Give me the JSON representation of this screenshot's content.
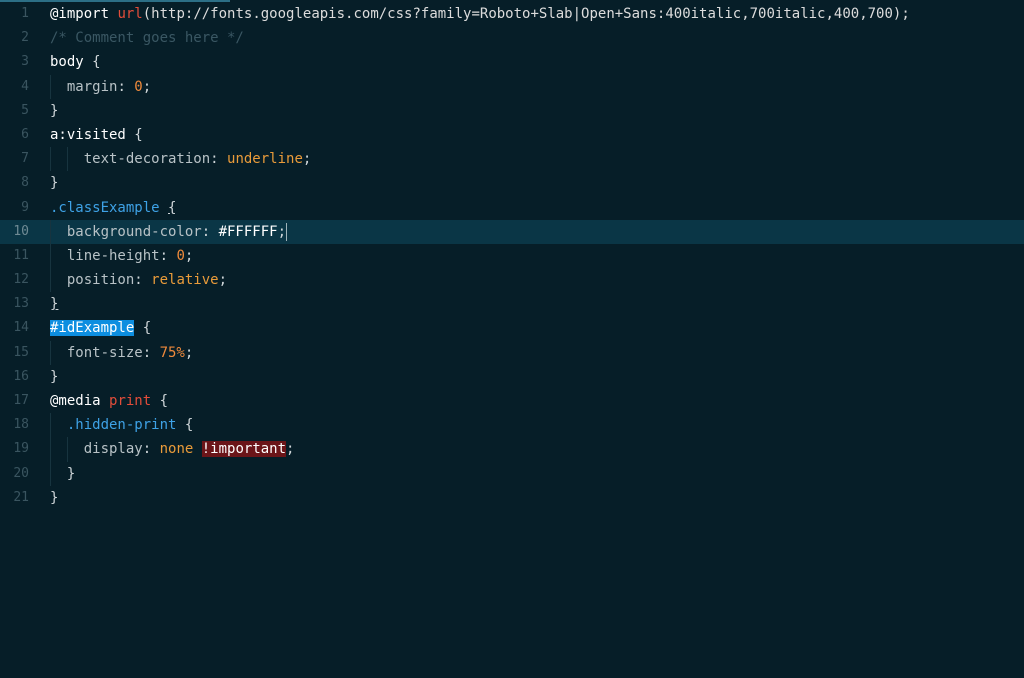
{
  "editor": {
    "language": "css",
    "active_line": 10,
    "lines": [
      {
        "num": "1",
        "tokens": [
          {
            "t": "@import",
            "c": "kw"
          },
          {
            "t": " "
          },
          {
            "t": "url",
            "c": "fn"
          },
          {
            "t": "(http://fonts.googleapis.com/css?family=Roboto+Slab|Open+Sans:400italic,700italic,400,700);",
            "c": "str"
          }
        ]
      },
      {
        "num": "2",
        "tokens": [
          {
            "t": "/* Comment goes here */",
            "c": "cm"
          }
        ]
      },
      {
        "num": "3",
        "tokens": [
          {
            "t": "body",
            "c": "kw"
          },
          {
            "t": " {",
            "c": "punct"
          }
        ]
      },
      {
        "num": "4",
        "tokens": [
          {
            "t": "  "
          },
          {
            "t": "margin",
            "c": "prop"
          },
          {
            "t": ": ",
            "c": "punct"
          },
          {
            "t": "0",
            "c": "num"
          },
          {
            "t": ";",
            "c": "punct"
          }
        ]
      },
      {
        "num": "5",
        "tokens": [
          {
            "t": "}",
            "c": "punct"
          }
        ]
      },
      {
        "num": "6",
        "tokens": [
          {
            "t": "a:visited",
            "c": "kw"
          },
          {
            "t": " {",
            "c": "punct"
          }
        ]
      },
      {
        "num": "7",
        "tokens": [
          {
            "t": "    "
          },
          {
            "t": "text-decoration",
            "c": "prop"
          },
          {
            "t": ": ",
            "c": "punct"
          },
          {
            "t": "underline",
            "c": "val"
          },
          {
            "t": ";",
            "c": "punct"
          }
        ]
      },
      {
        "num": "8",
        "tokens": [
          {
            "t": "}",
            "c": "punct"
          }
        ]
      },
      {
        "num": "9",
        "tokens": [
          {
            "t": ".classExample",
            "c": "sel-class"
          },
          {
            "t": " "
          },
          {
            "t": "{",
            "c": "punct underline-brace"
          }
        ]
      },
      {
        "num": "10",
        "tokens": [
          {
            "t": "  "
          },
          {
            "t": "background-color",
            "c": "prop"
          },
          {
            "t": ": ",
            "c": "punct"
          },
          {
            "t": "#FFFFFF",
            "c": "hex"
          },
          {
            "t": ";",
            "c": "punct"
          },
          {
            "t": "",
            "c": "cursor"
          }
        ]
      },
      {
        "num": "11",
        "tokens": [
          {
            "t": "  "
          },
          {
            "t": "line-height",
            "c": "prop"
          },
          {
            "t": ": ",
            "c": "punct"
          },
          {
            "t": "0",
            "c": "num"
          },
          {
            "t": ";",
            "c": "punct"
          }
        ]
      },
      {
        "num": "12",
        "tokens": [
          {
            "t": "  "
          },
          {
            "t": "position",
            "c": "prop"
          },
          {
            "t": ": ",
            "c": "punct"
          },
          {
            "t": "relative",
            "c": "val"
          },
          {
            "t": ";",
            "c": "punct"
          }
        ]
      },
      {
        "num": "13",
        "tokens": [
          {
            "t": "}",
            "c": "punct underline-brace"
          }
        ]
      },
      {
        "num": "14",
        "tokens": [
          {
            "t": "#idExample",
            "c": "hl-id"
          },
          {
            "t": " {",
            "c": "punct"
          }
        ]
      },
      {
        "num": "15",
        "tokens": [
          {
            "t": "  "
          },
          {
            "t": "font-size",
            "c": "prop"
          },
          {
            "t": ": ",
            "c": "punct"
          },
          {
            "t": "75%",
            "c": "num"
          },
          {
            "t": ";",
            "c": "punct"
          }
        ]
      },
      {
        "num": "16",
        "tokens": [
          {
            "t": "}",
            "c": "punct"
          }
        ]
      },
      {
        "num": "17",
        "tokens": [
          {
            "t": "@media",
            "c": "kw"
          },
          {
            "t": " "
          },
          {
            "t": "print",
            "c": "fn"
          },
          {
            "t": " {",
            "c": "punct"
          }
        ]
      },
      {
        "num": "18",
        "tokens": [
          {
            "t": "  "
          },
          {
            "t": ".hidden-print",
            "c": "sel-class"
          },
          {
            "t": " {",
            "c": "punct"
          }
        ]
      },
      {
        "num": "19",
        "tokens": [
          {
            "t": "    "
          },
          {
            "t": "display",
            "c": "prop"
          },
          {
            "t": ": ",
            "c": "punct"
          },
          {
            "t": "none",
            "c": "val"
          },
          {
            "t": " "
          },
          {
            "t": "!important",
            "c": "hl-imp"
          },
          {
            "t": ";",
            "c": "punct"
          }
        ]
      },
      {
        "num": "20",
        "tokens": [
          {
            "t": "  "
          },
          {
            "t": "}",
            "c": "punct"
          }
        ]
      },
      {
        "num": "21",
        "tokens": [
          {
            "t": "}",
            "c": "punct"
          }
        ]
      }
    ]
  },
  "colors": {
    "background": "#061e28",
    "active_line": "#0a3646",
    "id_highlight": "#0d8ee0",
    "important_highlight": "#6b1519"
  }
}
